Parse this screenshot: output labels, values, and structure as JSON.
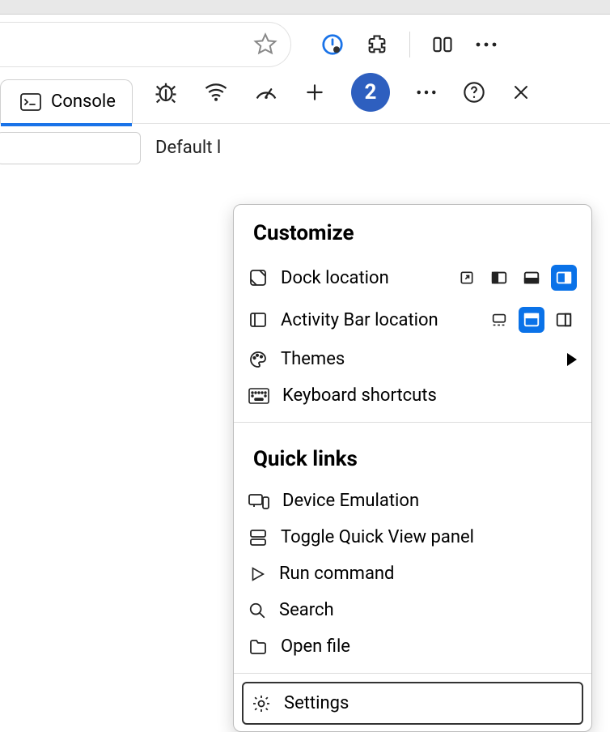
{
  "browser": {},
  "devtools": {
    "tab_console": "Console",
    "badge_count": "2",
    "default_levels": "Default l"
  },
  "dropdown": {
    "customize_title": "Customize",
    "dock_location": "Dock location",
    "activity_bar": "Activity Bar location",
    "themes": "Themes",
    "keyboard_shortcuts": "Keyboard shortcuts",
    "quick_links_title": "Quick links",
    "device_emulation": "Device Emulation",
    "toggle_quick_view": "Toggle Quick View panel",
    "run_command": "Run command",
    "search": "Search",
    "open_file": "Open file",
    "settings": "Settings"
  }
}
